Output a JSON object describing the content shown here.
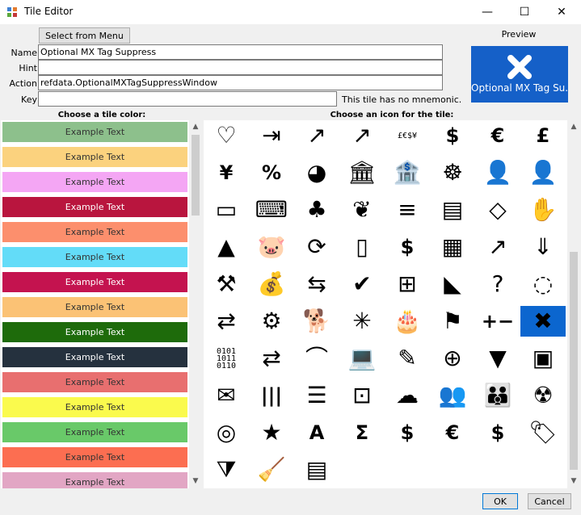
{
  "window": {
    "title": "Tile Editor",
    "minimize": "—",
    "maximize": "☐",
    "close": "✕"
  },
  "top": {
    "select_menu_label": "Select from Menu"
  },
  "form": {
    "name_label": "Name",
    "name_value": "Optional MX Tag Suppress",
    "hint_label": "Hint",
    "hint_value": "",
    "action_label": "Action",
    "action_value": "refdata.OptionalMXTagSuppressWindow",
    "key_label": "Key",
    "key_value": "",
    "mnemonic_note": "This tile has no mnemonic."
  },
  "preview": {
    "label": "Preview",
    "tile_text": "Optional MX Tag Su..."
  },
  "colors_header": "Choose a tile color:",
  "icons_header": "Choose an icon for the tile:",
  "swatches": [
    {
      "text": "Example Text",
      "bg": "#8dc08c",
      "fg": "#333333"
    },
    {
      "text": "Example Text",
      "bg": "#fbd27e",
      "fg": "#333333"
    },
    {
      "text": "Example Text",
      "bg": "#f4a6f4",
      "fg": "#333333"
    },
    {
      "text": "Example Text",
      "bg": "#b9153e",
      "fg": "#ffffff"
    },
    {
      "text": "Example Text",
      "bg": "#fc8f6d",
      "fg": "#333333"
    },
    {
      "text": "Example Text",
      "bg": "#63dcf8",
      "fg": "#333333"
    },
    {
      "text": "Example Text",
      "bg": "#c4134f",
      "fg": "#ffffff"
    },
    {
      "text": "Example Text",
      "bg": "#fbc275",
      "fg": "#333333"
    },
    {
      "text": "Example Text",
      "bg": "#1e6b0b",
      "fg": "#ffffff"
    },
    {
      "text": "Example Text",
      "bg": "#25313e",
      "fg": "#ffffff"
    },
    {
      "text": "Example Text",
      "bg": "#e86f6f",
      "fg": "#333333"
    },
    {
      "text": "Example Text",
      "bg": "#fafa4d",
      "fg": "#333333"
    },
    {
      "text": "Example Text",
      "bg": "#69c969",
      "fg": "#333333"
    },
    {
      "text": "Example Text",
      "bg": "#fc6e51",
      "fg": "#333333"
    },
    {
      "text": "Example Text",
      "bg": "#e2a6c4",
      "fg": "#333333"
    }
  ],
  "icons": [
    {
      "name": "heart-icon",
      "glyph": "♡"
    },
    {
      "name": "sign-in-icon",
      "glyph": "⇥"
    },
    {
      "name": "trend-up-icon",
      "glyph": "↗"
    },
    {
      "name": "trend-up-2-icon",
      "glyph": "↗"
    },
    {
      "name": "currencies-icon",
      "glyph": "£€$¥",
      "cls": "txt"
    },
    {
      "name": "dollar-coin-icon",
      "glyph": "$",
      "cls": "sym"
    },
    {
      "name": "euro-coin-icon",
      "glyph": "€",
      "cls": "sym"
    },
    {
      "name": "pound-coin-icon",
      "glyph": "£",
      "cls": "sym"
    },
    {
      "name": "yen-coin-icon",
      "glyph": "¥",
      "cls": "sym"
    },
    {
      "name": "percent-icon",
      "glyph": "%",
      "cls": "sym"
    },
    {
      "name": "pie-chart-icon",
      "glyph": "◕"
    },
    {
      "name": "bank-icon",
      "glyph": "🏛"
    },
    {
      "name": "bank-building-icon",
      "glyph": "🏦"
    },
    {
      "name": "presenter-icon",
      "glyph": "☸"
    },
    {
      "name": "user-icon",
      "glyph": "👤"
    },
    {
      "name": "user-document-icon",
      "glyph": "👤"
    },
    {
      "name": "credit-cards-icon",
      "glyph": "▭"
    },
    {
      "name": "cash-register-icon",
      "glyph": "⌨"
    },
    {
      "name": "money-plant-icon",
      "glyph": "♣"
    },
    {
      "name": "leaf-icon",
      "glyph": "❦"
    },
    {
      "name": "coin-stacks-icon",
      "glyph": "≡"
    },
    {
      "name": "banknotes-icon",
      "glyph": "▤"
    },
    {
      "name": "diamond-icon",
      "glyph": "◇"
    },
    {
      "name": "hand-money-icon",
      "glyph": "✋"
    },
    {
      "name": "gold-bars-icon",
      "glyph": "▲"
    },
    {
      "name": "piggy-bank-icon",
      "glyph": "🐷"
    },
    {
      "name": "dollar-refresh-icon",
      "glyph": "⟳"
    },
    {
      "name": "invoice-icon",
      "glyph": "▯"
    },
    {
      "name": "globe-dollar-icon",
      "glyph": "$",
      "cls": "sym"
    },
    {
      "name": "bar-chart-dollar-icon",
      "glyph": "▦"
    },
    {
      "name": "growth-chart-icon",
      "glyph": "↗"
    },
    {
      "name": "sort-down-icon",
      "glyph": "⇓"
    },
    {
      "name": "gavel-icon",
      "glyph": "⚒"
    },
    {
      "name": "money-bag-icon",
      "glyph": "💰"
    },
    {
      "name": "transfer-arrows-icon",
      "glyph": "⇆"
    },
    {
      "name": "checkmark-icon",
      "glyph": "✔"
    },
    {
      "name": "add-cards-icon",
      "glyph": "⊞"
    },
    {
      "name": "alert-chart-icon",
      "glyph": "◣"
    },
    {
      "name": "question-document-icon",
      "glyph": "?"
    },
    {
      "name": "circular-arrows-icon",
      "glyph": "◌"
    },
    {
      "name": "exchange-arrows-icon",
      "glyph": "⇄"
    },
    {
      "name": "gears-icon",
      "glyph": "⚙"
    },
    {
      "name": "dog-icon",
      "glyph": "🐕"
    },
    {
      "name": "spider-web-icon",
      "glyph": "✳"
    },
    {
      "name": "birthday-cake-icon",
      "glyph": "🎂"
    },
    {
      "name": "flag-icon",
      "glyph": "⚑"
    },
    {
      "name": "plus-minus-icon",
      "glyph": "+−",
      "cls": "sym"
    },
    {
      "name": "close-x-icon",
      "glyph": "✖"
    },
    {
      "name": "binary-icon",
      "glyph": "0101\n1011\n0110",
      "cls": "txt"
    },
    {
      "name": "swap-box-icon",
      "glyph": "⇄"
    },
    {
      "name": "curve-chart-icon",
      "glyph": "⌒"
    },
    {
      "name": "laptop-icon",
      "glyph": "💻"
    },
    {
      "name": "edit-pencil-icon",
      "glyph": "✎"
    },
    {
      "name": "globe-icon",
      "glyph": "⊕"
    },
    {
      "name": "filter-check-icon",
      "glyph": "▼"
    },
    {
      "name": "image-icon",
      "glyph": "▣"
    },
    {
      "name": "envelope-icon",
      "glyph": "✉"
    },
    {
      "name": "columns-icon",
      "glyph": "|||",
      "cls": "sym"
    },
    {
      "name": "menu-lines-icon",
      "glyph": "☰"
    },
    {
      "name": "network-icon",
      "glyph": "⊡"
    },
    {
      "name": "cloud-computer-icon",
      "glyph": "☁"
    },
    {
      "name": "users-icon",
      "glyph": "👥"
    },
    {
      "name": "group-icon",
      "glyph": "👪"
    },
    {
      "name": "radiation-icon",
      "glyph": "☢"
    },
    {
      "name": "target-icon",
      "glyph": "◎"
    },
    {
      "name": "star-icon",
      "glyph": "★"
    },
    {
      "name": "text-frame-icon",
      "glyph": "A",
      "cls": "sym"
    },
    {
      "name": "engine-sigma-icon",
      "glyph": "Σ",
      "cls": "sym"
    },
    {
      "name": "engine-dollar-icon",
      "glyph": "$",
      "cls": "sym"
    },
    {
      "name": "engine-euro-icon",
      "glyph": "€",
      "cls": "sym"
    },
    {
      "name": "dollar-trend-icon",
      "glyph": "$",
      "cls": "sym"
    },
    {
      "name": "price-tag-icon",
      "glyph": "🏷"
    },
    {
      "name": "funnel-dollar-icon",
      "glyph": "⧩"
    },
    {
      "name": "cleanup-money-icon",
      "glyph": "🧹"
    },
    {
      "name": "data-transfer-icon",
      "glyph": "▤"
    }
  ]
}
